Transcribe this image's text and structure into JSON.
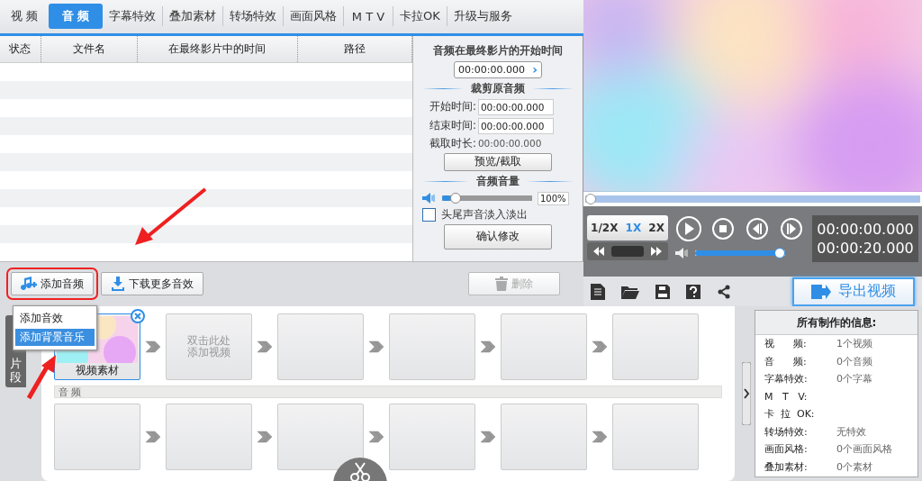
{
  "tabs": [
    {
      "label": "视 频",
      "selected": false
    },
    {
      "label": "音 频",
      "selected": true
    },
    {
      "label": "字幕特效",
      "selected": false
    },
    {
      "label": "叠加素材",
      "selected": false
    },
    {
      "label": "转场特效",
      "selected": false
    },
    {
      "label": "画面风格",
      "selected": false
    },
    {
      "label": "M T V",
      "selected": false
    },
    {
      "label": "卡拉OK",
      "selected": false
    },
    {
      "label": "升级与服务",
      "selected": false
    }
  ],
  "table": {
    "columns": [
      "状态",
      "文件名",
      "在最终影片中的时间",
      "路径"
    ]
  },
  "audio_settings": {
    "start_title": "音频在最终影片的开始时间",
    "start_value": "00:00:00.000",
    "next": "›",
    "trim_title": "裁剪原音频",
    "trim_fields": [
      {
        "label": "开始时间:",
        "value": "00:00:00.000",
        "kind": "input"
      },
      {
        "label": "结束时间:",
        "value": "00:00:00.000",
        "kind": "input"
      },
      {
        "label": "截取时长:",
        "value": "00:00:00.000",
        "kind": "text"
      }
    ],
    "preview_button": "预览/截取",
    "volume_title": "音频音量",
    "volume": {
      "level": 0.1,
      "reading": "100%"
    },
    "fade": {
      "label": "头尾声音淡入淡出",
      "checked": false
    },
    "confirm_button": "确认修改"
  },
  "actions": [
    {
      "label": "添加音频",
      "kind": "add",
      "disabled": false
    },
    {
      "label": "下载更多音效",
      "kind": "download",
      "disabled": false
    },
    {
      "label": "删除",
      "kind": "delete",
      "disabled": true
    }
  ],
  "add_menu": [
    {
      "label": "添加音效",
      "selected": false
    },
    {
      "label": "添加背景音乐",
      "selected": true
    }
  ],
  "player": {
    "progress": {
      "level": 0
    },
    "speeds": [
      {
        "label": "1/2X",
        "selected": false
      },
      {
        "label": "1X",
        "selected": true
      },
      {
        "label": "2X",
        "selected": false
      }
    ],
    "volume": {
      "level": 1
    },
    "current_time": "00:00:00.000",
    "total_time": "00:00:20.000",
    "export_button": "导出视频"
  },
  "side_tab": "片段",
  "video_track": [
    {
      "kind": "clip",
      "label": "视频素材",
      "selected": true
    },
    {
      "kind": "add",
      "lines": [
        "双击此处",
        "添加视频"
      ]
    },
    {
      "kind": "empty"
    },
    {
      "kind": "empty"
    },
    {
      "kind": "empty"
    },
    {
      "kind": "empty"
    }
  ],
  "audio_track": {
    "label": "音 频",
    "slots": [
      {
        "kind": "empty"
      },
      {
        "kind": "empty"
      },
      {
        "kind": "empty"
      },
      {
        "kind": "empty"
      },
      {
        "kind": "empty"
      },
      {
        "kind": "empty"
      }
    ]
  },
  "info": {
    "title": "所有制作的信息:",
    "items": [
      {
        "label": "视      频:",
        "value": "1个视频"
      },
      {
        "label": "音      频:",
        "value": "0个音频"
      },
      {
        "label": "字幕特效:",
        "value": "0个字幕"
      },
      {
        "label": "M   T   V:"
      },
      {
        "label": "卡  拉  OK:"
      },
      {
        "label": "转场特效:",
        "value": "无特效"
      },
      {
        "label": "画面风格:",
        "value": "0个画面风格"
      },
      {
        "label": "叠加素材:",
        "value": "0个素材"
      }
    ]
  }
}
